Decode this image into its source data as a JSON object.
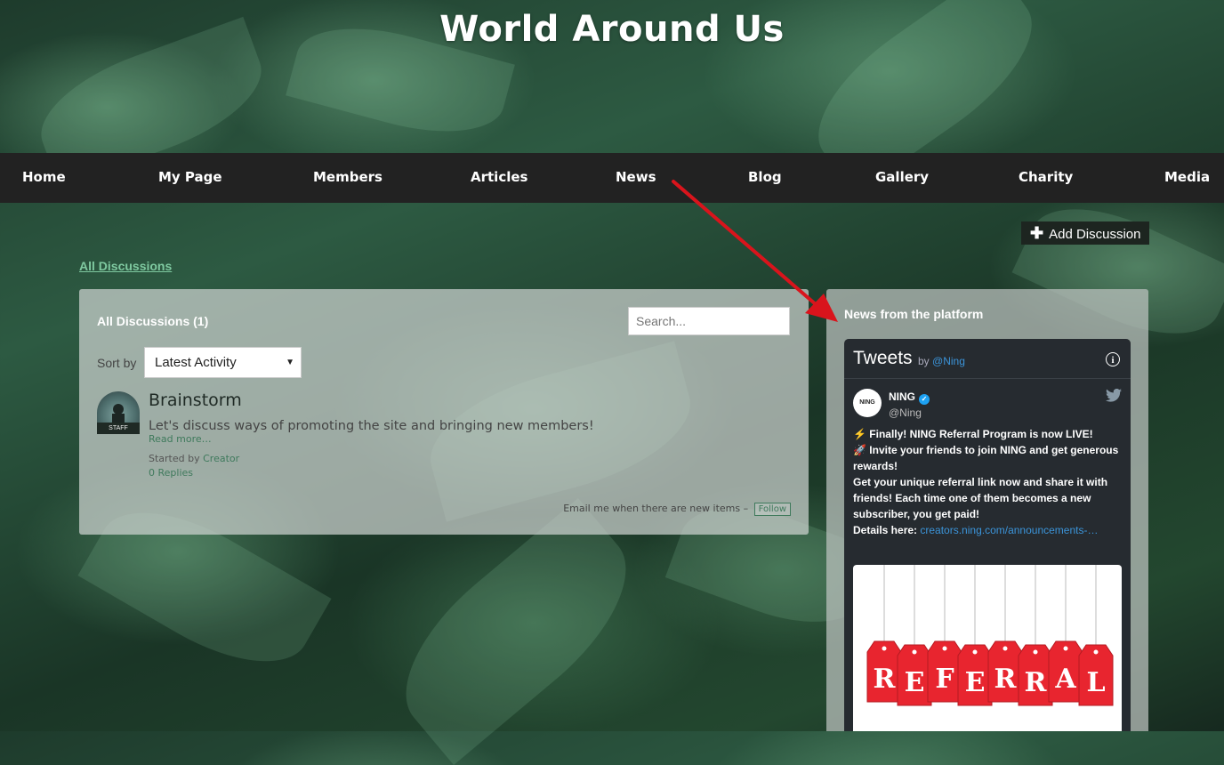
{
  "site": {
    "title": "World Around Us"
  },
  "nav": {
    "items": [
      "Home",
      "My Page",
      "Members",
      "Articles",
      "News",
      "Blog",
      "Gallery",
      "Charity",
      "Media"
    ]
  },
  "actions": {
    "add_discussion": "Add Discussion"
  },
  "breadcrumb": {
    "all_discussions": "All Discussions"
  },
  "discussions": {
    "title": "All Discussions (1)",
    "search_placeholder": "Search...",
    "sort_label": "Sort by",
    "sort_value": "Latest Activity",
    "items": [
      {
        "badge": "STAFF",
        "title": "Brainstorm",
        "description": "Let's discuss ways of promoting the site and bringing new members!",
        "read_more": "Read more…",
        "started_by_prefix": "Started by",
        "started_by": "Creator",
        "replies": "0 Replies"
      }
    ],
    "email_text": "Email me when there are new items –",
    "follow_label": "Follow"
  },
  "sidebar": {
    "title": "News from the platform",
    "tweets": {
      "header": "Tweets",
      "by": "by",
      "handle": "@Ning",
      "author_name": "NING",
      "author_handle": "@Ning",
      "avatar_text": "NING",
      "line1": "⚡ Finally! NING Referral Program is now LIVE!",
      "line2": "🚀 Invite your friends to join NING and get generous rewards!",
      "line3": "Get your unique referral link now and share it with friends! Each time one of them becomes a new subscriber, you get paid!",
      "details_label": "Details here:",
      "details_link": "creators.ning.com/announcements-…",
      "image_letters": [
        "R",
        "E",
        "F",
        "E",
        "R",
        "R",
        "A",
        "L"
      ]
    }
  },
  "colors": {
    "navbar": "#222222",
    "link_green": "#7fc9a0",
    "tag_red": "#e8252f",
    "arrow_red": "#d9141c",
    "twitter_blue": "#1da1f2"
  },
  "icons": [
    "plus-icon",
    "info-icon",
    "verified-icon",
    "twitter-bird-icon",
    "dropdown-caret-icon"
  ]
}
